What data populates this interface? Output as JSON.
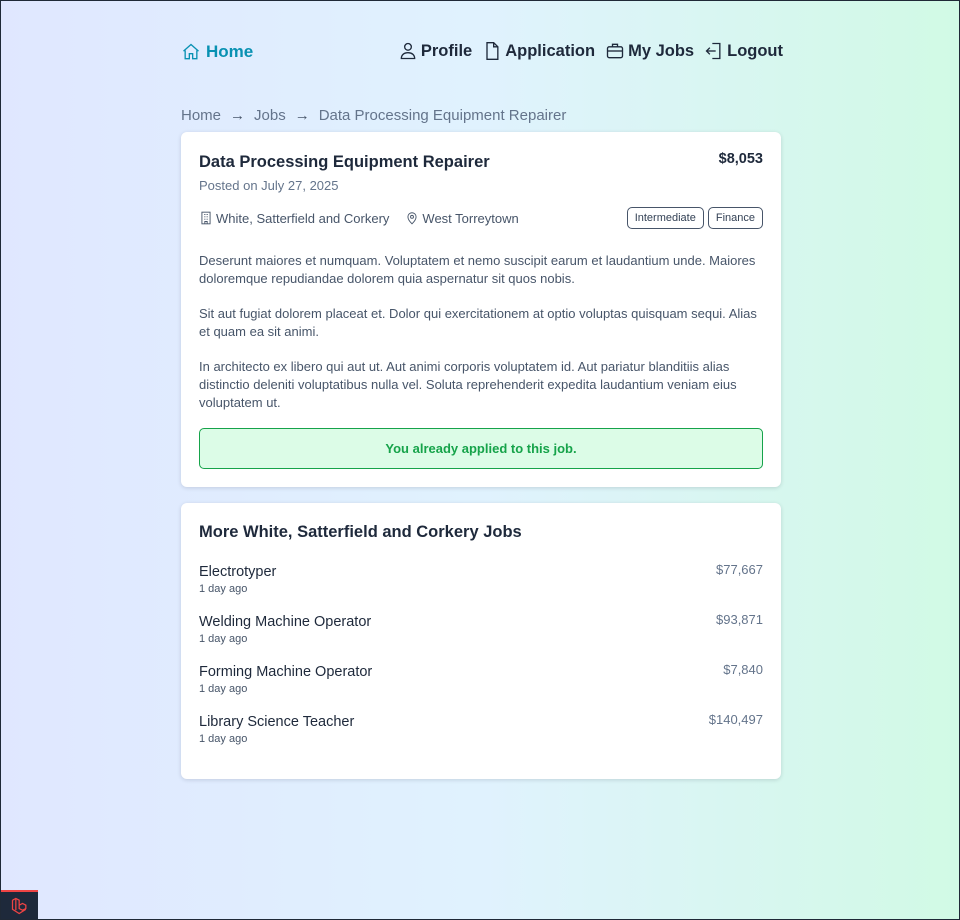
{
  "nav": {
    "home_label": "Home",
    "profile_label": "Profile",
    "application_label": "Application",
    "my_jobs_label": "My Jobs",
    "logout_label": "Logout"
  },
  "breadcrumb": {
    "items": [
      "Home",
      "Jobs",
      "Data Processing Equipment Repairer"
    ],
    "separator": "→"
  },
  "job": {
    "title": "Data Processing Equipment Repairer",
    "salary": "$8,053",
    "posted": "Posted on July 27, 2025",
    "company": "White, Satterfield and Corkery",
    "location": "West Torreytown",
    "tags": [
      "Intermediate",
      "Finance"
    ],
    "description": [
      "Deserunt maiores et numquam. Voluptatem et nemo suscipit earum et laudantium unde. Maiores doloremque repudiandae dolorem quia aspernatur sit quos nobis.",
      "Sit aut fugiat dolorem placeat et. Dolor qui exercitationem at optio voluptas quisquam sequi. Alias et quam ea sit animi.",
      "In architecto ex libero qui aut ut. Aut animi corporis voluptatem id. Aut pariatur blanditiis alias distinctio deleniti voluptatibus nulla vel. Soluta reprehenderit expedita laudantium veniam eius voluptatem ut."
    ],
    "applied_message": "You already applied to this job."
  },
  "more_jobs": {
    "title": "More White, Satterfield and Corkery Jobs",
    "items": [
      {
        "name": "Electrotyper",
        "time": "1 day ago",
        "salary": "$77,667"
      },
      {
        "name": "Welding Machine Operator",
        "time": "1 day ago",
        "salary": "$93,871"
      },
      {
        "name": "Forming Machine Operator",
        "time": "1 day ago",
        "salary": "$7,840"
      },
      {
        "name": "Library Science Teacher",
        "time": "1 day ago",
        "salary": "$140,497"
      }
    ]
  },
  "colors": {
    "accent": "#0891b2",
    "success": "#16a34a",
    "success_bg": "#dcfce7"
  }
}
